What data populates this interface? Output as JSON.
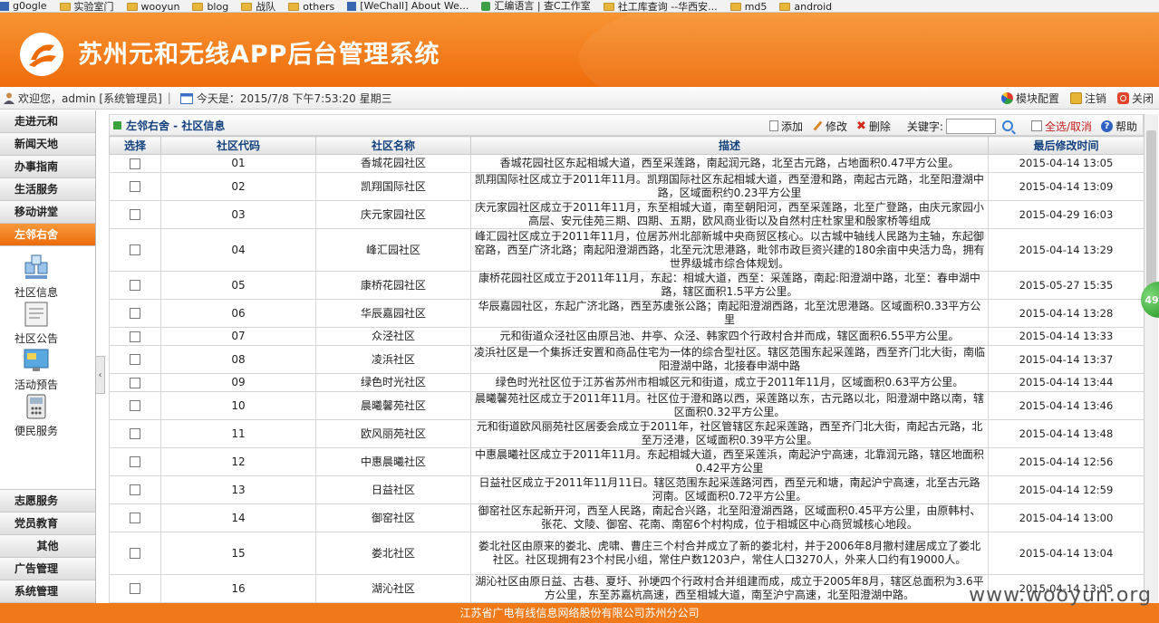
{
  "bookmarks": [
    {
      "label": "g0ogle",
      "icon": "sq"
    },
    {
      "label": "实验室门",
      "icon": "folder"
    },
    {
      "label": "wooyun",
      "icon": "folder"
    },
    {
      "label": "blog",
      "icon": "folder"
    },
    {
      "label": "战队",
      "icon": "folder"
    },
    {
      "label": "others",
      "icon": "folder"
    },
    {
      "label": "[WeChall] About We...",
      "icon": "sq"
    },
    {
      "label": "汇编语言 | 查C工作室",
      "icon": "chk"
    },
    {
      "label": "社工库查询 --华西安...",
      "icon": "folder"
    },
    {
      "label": "md5",
      "icon": "folder"
    },
    {
      "label": "android",
      "icon": "folder"
    }
  ],
  "header": {
    "title": "苏州元和无线APP后台管理系统"
  },
  "infobar": {
    "welcome": "欢迎您，admin [系统管理员]",
    "date": "今天是：2015/7/8 下午7:53:20 星期三",
    "module_config": "模块配置",
    "logout": "注销",
    "close": "关闭"
  },
  "sidebar": {
    "top_items": [
      "走进元和",
      "新闻天地",
      "办事指南",
      "生活服务",
      "移动讲堂",
      "左邻右舍"
    ],
    "sub_items": [
      "社区信息",
      "社区公告",
      "活动预告",
      "便民服务"
    ],
    "bottom_items": [
      "志愿服务",
      "党员教育",
      "其他",
      "广告管理",
      "系统管理"
    ]
  },
  "toolbar": {
    "breadcrumb": "左邻右舍 - 社区信息",
    "add": "添加",
    "edit": "修改",
    "delete": "删除",
    "keyword_label": "关键字:",
    "keyword_value": "",
    "select_all": "全选/取消",
    "help": "帮助"
  },
  "table": {
    "headers": [
      "选择",
      "社区代码",
      "社区名称",
      "描述",
      "最后修改时间"
    ],
    "rows": [
      {
        "code": "01",
        "name": "香城花园社区",
        "desc": "香城花园社区东起相城大道，西至采莲路，南起润元路，北至古元路，占地面积0.47平方公里。",
        "time": "2015-04-14 13:05"
      },
      {
        "code": "02",
        "name": "凯翔国际社区",
        "desc": "凯翔国际社区成立于2011年11月。凯翔国际社区东起相城大道，西至澄和路，南起古元路，北至阳澄湖中路，区域面积约0.23平方公里",
        "time": "2015-04-14 13:09"
      },
      {
        "code": "03",
        "name": "庆元家园社区",
        "desc": "庆元家园社区成立于2011年11月，东至相城大道，南至朝阳河，西至采莲路，北至广登路，由庆元家园小高层、安元佳苑三期、四期、五期，欧风商业街以及自然村庄杜家里和殷家桥等组成",
        "time": "2015-04-29 16:03"
      },
      {
        "code": "04",
        "name": "峰汇园社区",
        "desc": "峰汇园社区成立于2011年11月，位居苏州北部新城中央商贸区核心。以古城中轴线人民路为主轴，东起御窑路，西至广济北路；南起阳澄湖西路，北至元沈思港路，毗邻市政巨资兴建的180余亩中央活力岛，拥有世界级城市综合体规划。",
        "time": "2015-04-14 13:29"
      },
      {
        "code": "05",
        "name": "康桥花园社区",
        "desc": "康桥花园社区成立于2011年11月，东起：相城大道，西至：采莲路，南起:阳澄湖中路，北至：春申湖中路，辖区面积1.5平方公里。",
        "time": "2015-05-27 15:35"
      },
      {
        "code": "06",
        "name": "华辰嘉园社区",
        "desc": "华辰嘉园社区，东起广济北路，西至苏虞张公路；南起阳澄湖西路，北至沈思港路。区域面积0.33平方公里",
        "time": "2015-04-14 13:28"
      },
      {
        "code": "07",
        "name": "众泾社区",
        "desc": "元和街道众泾社区由原吕池、井亭、众泾、韩家四个行政村合并而成，辖区面积6.55平方公里。",
        "time": "2015-04-14 13:33"
      },
      {
        "code": "08",
        "name": "凌浜社区",
        "desc": "凌浜社区是一个集拆迁安置和商品住宅为一体的综合型社区。辖区范围东起采莲路，西至齐门北大街，南临阳澄湖中路，北接春申湖中路",
        "time": "2015-04-14 13:37"
      },
      {
        "code": "09",
        "name": "绿色时光社区",
        "desc": "绿色时光社区位于江苏省苏州市相城区元和街道，成立于2011年11月，区域面积0.63平方公里。",
        "time": "2015-04-14 13:44"
      },
      {
        "code": "10",
        "name": "晨曦馨苑社区",
        "desc": "晨曦馨苑社区成立于2011年11月。社区位于澄和路以西，采莲路以东，古元路以北，阳澄湖中路以南，辖区面积0.32平方公里。",
        "time": "2015-04-14 13:46"
      },
      {
        "code": "11",
        "name": "欧风丽苑社区",
        "desc": "元和街道欧风丽苑社区居委会成立于2011年，社区管辖区东起采莲路，西至齐门北大街，南起古元路，北至万泾港，区域面积0.39平方公里。",
        "time": "2015-04-14 13:48"
      },
      {
        "code": "12",
        "name": "中惠晨曦社区",
        "desc": "中惠晨曦社区成立于2011年11月。东起相城大道，西至采莲浜，南起沪宁高速，北靠润元路，辖区地面积0.42平方公里",
        "time": "2015-04-14 12:56"
      },
      {
        "code": "13",
        "name": "日益社区",
        "desc": "日益社区成立于2011年11月11日。辖区范围东起采莲路河西，西至元和塘，南起沪宁高速，北至古元路河南。区域面积0.72平方公里。",
        "time": "2015-04-14 12:59"
      },
      {
        "code": "14",
        "name": "御窑社区",
        "desc": "御窑社区东起新开河，西至人民路，南起合兴路，北至阳澄湖西路，区域面积0.45平方公里，由原韩村、张花、文陵、御窑、花南、南窑6个村构成，位于相城区中心商贸城核心地段。",
        "time": "2015-04-14 13:00"
      },
      {
        "code": "15",
        "name": "娄北社区",
        "desc": "娄北社区由原来的娄北、虎啸、曹庄三个村合并成立了新的娄北村，并于2006年8月撤村建居成立了娄北社区。社区现拥有23个村民小组，常住户数1203户，常住人口3270人，外来人口约有19000人。",
        "time": "2015-04-14 13:04"
      },
      {
        "code": "16",
        "name": "湖沁社区",
        "desc": "湖沁社区由原日益、古巷、夏圩、孙埂四个行政村合并组建而成，成立于2005年8月，辖区总面积为3.6平方公里，东至苏嘉杭高速，西至相城大道，南至沪宁高速，北至阳澄湖中路。",
        "time": "2015-04-14 13:05"
      }
    ]
  },
  "floater": "49",
  "footer": "江苏省广电有线信息网络股份有限公司苏州分公司",
  "watermark": "www.wooyun.org"
}
